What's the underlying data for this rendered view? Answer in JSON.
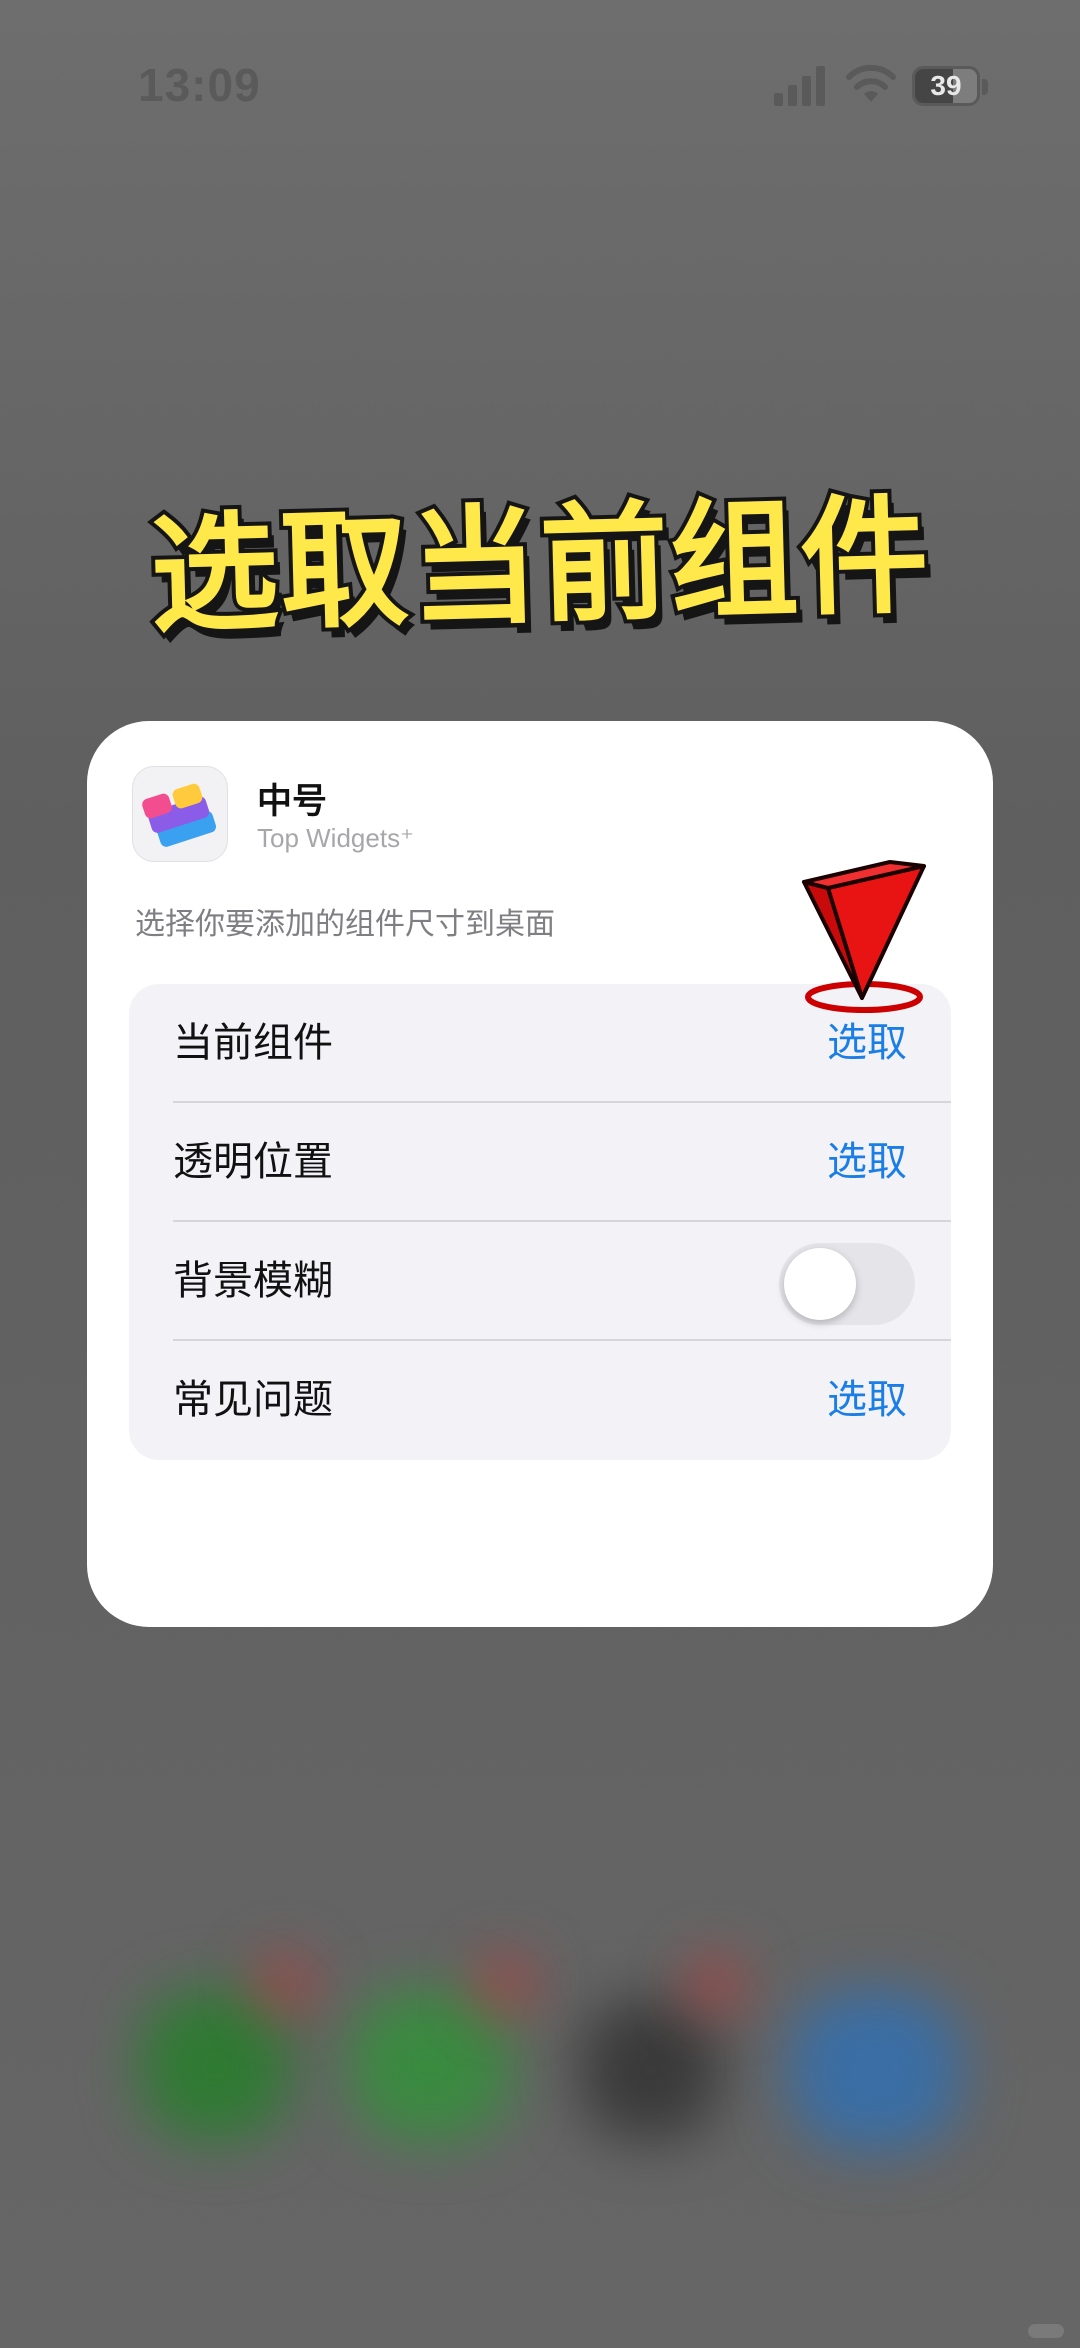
{
  "status_bar": {
    "time": "13:09",
    "battery_percent": "39"
  },
  "overlay": {
    "title": "选取当前组件"
  },
  "sheet": {
    "size_title": "中号",
    "app_name": "Top Widgets⁺",
    "description": "选择你要添加的组件尺寸到桌面",
    "rows": [
      {
        "label": "当前组件",
        "action": "选取"
      },
      {
        "label": "透明位置",
        "action": "选取"
      },
      {
        "label": "背景模糊",
        "toggle_on": false
      },
      {
        "label": "常见问题",
        "action": "选取"
      }
    ]
  },
  "colors": {
    "accent": "#1a7ee6",
    "pointer": "#e01010",
    "overlay_text": "#ffe84a"
  },
  "icons": [
    "cellular-signal-icon",
    "wifi-icon",
    "battery-icon",
    "app-icon-top-widgets",
    "red-pointer-icon"
  ]
}
